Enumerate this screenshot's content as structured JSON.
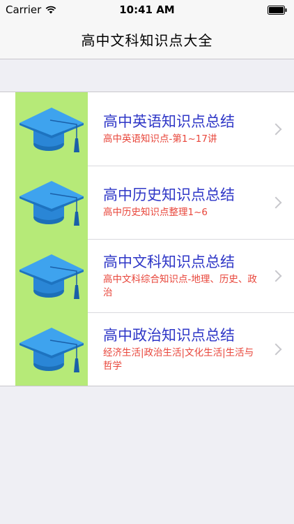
{
  "status_bar": {
    "carrier": "Carrier",
    "time": "10:41 AM",
    "wifi_icon": "wifi-icon",
    "battery_icon": "battery-icon"
  },
  "nav": {
    "title": "高中文科知识点大全"
  },
  "list": {
    "items": [
      {
        "title": "高中英语知识点总结",
        "subtitle": "高中英语知识点-第1~17讲",
        "icon": "graduation-cap-icon"
      },
      {
        "title": "高中历史知识点总结",
        "subtitle": "高中历史知识点整理1~6",
        "icon": "graduation-cap-icon"
      },
      {
        "title": "高中文科知识点总结",
        "subtitle": "高中文科综合知识点-地理、历史、政治",
        "icon": "graduation-cap-icon"
      },
      {
        "title": "高中政治知识点总结",
        "subtitle": "经济生活|政治生活|文化生活|生活与哲学",
        "icon": "graduation-cap-icon"
      }
    ]
  },
  "colors": {
    "title_blue": "#2f37c7",
    "subtitle_red": "#e8453a",
    "thumb_green": "#b6ea78",
    "background": "#efeff4"
  }
}
